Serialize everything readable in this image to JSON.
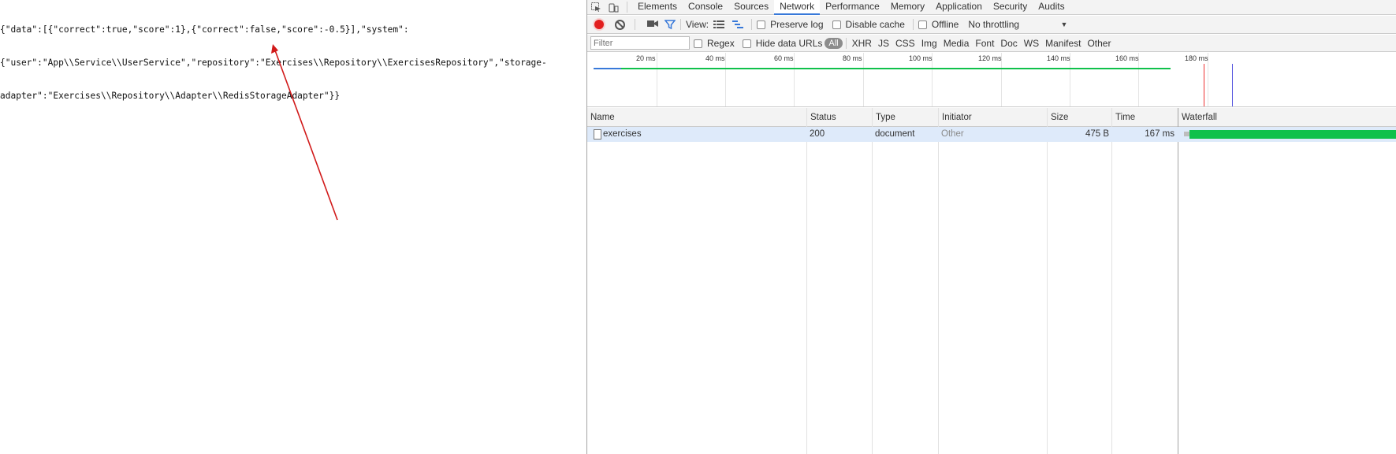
{
  "page": {
    "json_lines": [
      "{\"data\":[{\"correct\":true,\"score\":1},{\"correct\":false,\"score\":-0.5}],\"system\":",
      "{\"user\":\"App\\\\Service\\\\UserService\",\"repository\":\"Exercises\\\\Repository\\\\ExercisesRepository\",\"storage-",
      "adapter\":\"Exercises\\\\Repository\\\\Adapter\\\\RedisStorageAdapter\"}}"
    ],
    "arrow_color": "#d11a1a"
  },
  "devtools": {
    "tabs": [
      "Elements",
      "Console",
      "Sources",
      "Network",
      "Performance",
      "Memory",
      "Application",
      "Security",
      "Audits"
    ],
    "active_tab": "Network",
    "toolbar": {
      "view_label": "View:",
      "preserve_log": "Preserve log",
      "disable_cache": "Disable cache",
      "offline": "Offline",
      "throttling": "No throttling"
    },
    "filterbar": {
      "filter_placeholder": "Filter",
      "regex": "Regex",
      "hide_data_urls": "Hide data URLs",
      "types": [
        "All",
        "XHR",
        "JS",
        "CSS",
        "Img",
        "Media",
        "Font",
        "Doc",
        "WS",
        "Manifest",
        "Other"
      ]
    },
    "overview_ticks": [
      "20 ms",
      "40 ms",
      "60 ms",
      "80 ms",
      "100 ms",
      "120 ms",
      "140 ms",
      "160 ms",
      "180 ms"
    ],
    "columns": [
      "Name",
      "Status",
      "Type",
      "Initiator",
      "Size",
      "Time",
      "Waterfall"
    ],
    "rows": [
      {
        "name": "exercises",
        "status": "200",
        "type": "document",
        "initiator": "Other",
        "size": "475 B",
        "time": "167 ms"
      }
    ],
    "colors": {
      "accent": "#3879d9",
      "record": "#e21f1f",
      "waterfall_bar": "#0fc14b",
      "selected_row": "#deeafa"
    }
  }
}
